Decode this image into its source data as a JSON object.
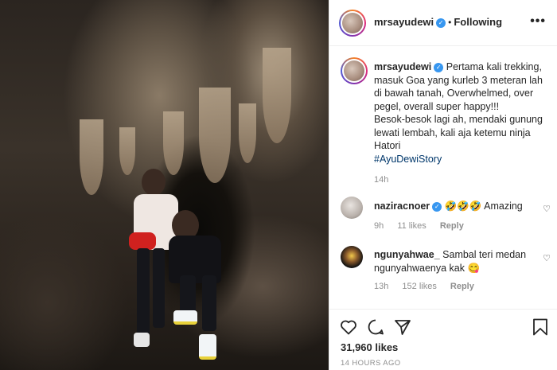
{
  "post": {
    "username": "mrsayudewi",
    "separator": "•",
    "follow_status": "Following",
    "more_label": "•••",
    "caption": {
      "username": "mrsayudewi",
      "line1": "Pertama kali trekking,",
      "line2": "masuk Goa yang kurleb 3 meteran lah",
      "line3": "di bawah tanah, Overwhelmed, over",
      "line4": "pegel, overall super happy!!!",
      "line5": "Besok-besok lagi ah, mendaki gunung",
      "line6": "lewati lembah, kali aja ketemu ninja",
      "line7": "Hatori",
      "hashtag": "#AyuDewiStory",
      "time": "14h"
    },
    "comments": [
      {
        "username": "naziracnoer",
        "text": "🤣🤣🤣 Amazing",
        "time": "9h",
        "likes": "11 likes",
        "reply": "Reply"
      },
      {
        "username": "ngunyahwae_",
        "text": "Sambal teri medan",
        "text2": "ngunyahwaenya kak 😋",
        "time": "13h",
        "likes": "152 likes",
        "reply": "Reply"
      }
    ],
    "likes_count": "31,960 likes",
    "posted_ago": "14 HOURS AGO"
  },
  "icons": [
    "heart-icon",
    "comment-icon",
    "share-icon",
    "bookmark-icon",
    "verified-icon",
    "more-icon"
  ],
  "colors": {
    "verified": "#3897f0",
    "hashtag": "#00376b",
    "muted": "#8e8e8e",
    "text": "#262626"
  }
}
